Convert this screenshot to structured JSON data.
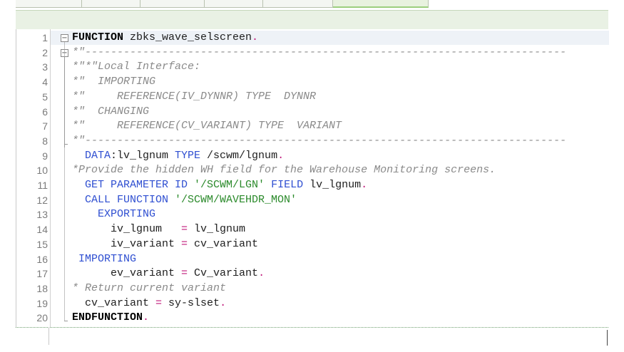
{
  "tabs": [
    {
      "label": ""
    },
    {
      "label": ""
    },
    {
      "label": ""
    },
    {
      "label": ""
    },
    {
      "label": ""
    },
    {
      "label": "",
      "active": true
    }
  ],
  "editor": {
    "lines": [
      {
        "no": "1",
        "segs": [
          {
            "t": "FUNCTION",
            "c": "kwb"
          },
          {
            "t": " zbks_wave_selscreen",
            "c": ""
          },
          {
            "t": ".",
            "c": "dot"
          }
        ],
        "fold": "minus"
      },
      {
        "no": "2",
        "segs": [
          {
            "t": "*\"---------------------------------------------------------------------------",
            "c": "com"
          }
        ],
        "fold": "minus2"
      },
      {
        "no": "3",
        "segs": [
          {
            "t": "*\"*\"Local Interface:",
            "c": "com"
          }
        ]
      },
      {
        "no": "4",
        "segs": [
          {
            "t": "*\"  IMPORTING",
            "c": "com"
          }
        ]
      },
      {
        "no": "5",
        "segs": [
          {
            "t": "*\"     REFERENCE(IV_DYNNR) TYPE  DYNNR",
            "c": "com"
          }
        ]
      },
      {
        "no": "6",
        "segs": [
          {
            "t": "*\"  CHANGING",
            "c": "com"
          }
        ]
      },
      {
        "no": "7",
        "segs": [
          {
            "t": "*\"     REFERENCE(CV_VARIANT) TYPE  VARIANT",
            "c": "com"
          }
        ]
      },
      {
        "no": "8",
        "segs": [
          {
            "t": "*\"---------------------------------------------------------------------------",
            "c": "com"
          }
        ],
        "fold": "end"
      },
      {
        "no": "9",
        "segs": [
          {
            "t": "  DATA",
            "c": "kw"
          },
          {
            "t": ":lv_lgnum ",
            "c": ""
          },
          {
            "t": "TYPE",
            "c": "kw"
          },
          {
            "t": " /scwm/lgnum",
            "c": ""
          },
          {
            "t": ".",
            "c": "dot"
          }
        ]
      },
      {
        "no": "10",
        "segs": [
          {
            "t": "*Provide the hidden WH field for the Warehouse Monitoring screens.",
            "c": "com"
          }
        ]
      },
      {
        "no": "11",
        "segs": [
          {
            "t": "  GET PARAMETER ID ",
            "c": "kw"
          },
          {
            "t": "'/SCWM/LGN'",
            "c": "str"
          },
          {
            "t": " FIELD",
            "c": "kw"
          },
          {
            "t": " lv_lgnum",
            "c": ""
          },
          {
            "t": ".",
            "c": "dot"
          }
        ]
      },
      {
        "no": "12",
        "segs": [
          {
            "t": "  CALL FUNCTION ",
            "c": "kw"
          },
          {
            "t": "'/SCWM/WAVEHDR_MON'",
            "c": "str"
          }
        ]
      },
      {
        "no": "13",
        "segs": [
          {
            "t": "    EXPORTING",
            "c": "kw"
          }
        ]
      },
      {
        "no": "14",
        "segs": [
          {
            "t": "      iv_lgnum   ",
            "c": ""
          },
          {
            "t": "=",
            "c": "dot"
          },
          {
            "t": " lv_lgnum",
            "c": ""
          }
        ]
      },
      {
        "no": "15",
        "segs": [
          {
            "t": "      iv_variant ",
            "c": ""
          },
          {
            "t": "=",
            "c": "dot"
          },
          {
            "t": " cv_variant",
            "c": ""
          }
        ]
      },
      {
        "no": "16",
        "segs": [
          {
            "t": " IMPORTING",
            "c": "kw"
          }
        ]
      },
      {
        "no": "17",
        "segs": [
          {
            "t": "      ev_variant ",
            "c": ""
          },
          {
            "t": "=",
            "c": "dot"
          },
          {
            "t": " Cv_variant",
            "c": ""
          },
          {
            "t": ".",
            "c": "dot"
          }
        ]
      },
      {
        "no": "18",
        "segs": [
          {
            "t": "* Return current variant",
            "c": "com"
          }
        ]
      },
      {
        "no": "19",
        "segs": [
          {
            "t": "  cv_variant ",
            "c": ""
          },
          {
            "t": "=",
            "c": "dot"
          },
          {
            "t": " sy-slset",
            "c": ""
          },
          {
            "t": ".",
            "c": "dot"
          }
        ]
      },
      {
        "no": "20",
        "segs": [
          {
            "t": "ENDFUNCTION",
            "c": "kwb"
          },
          {
            "t": ".",
            "c": "dot"
          }
        ],
        "fold": "final"
      }
    ]
  }
}
